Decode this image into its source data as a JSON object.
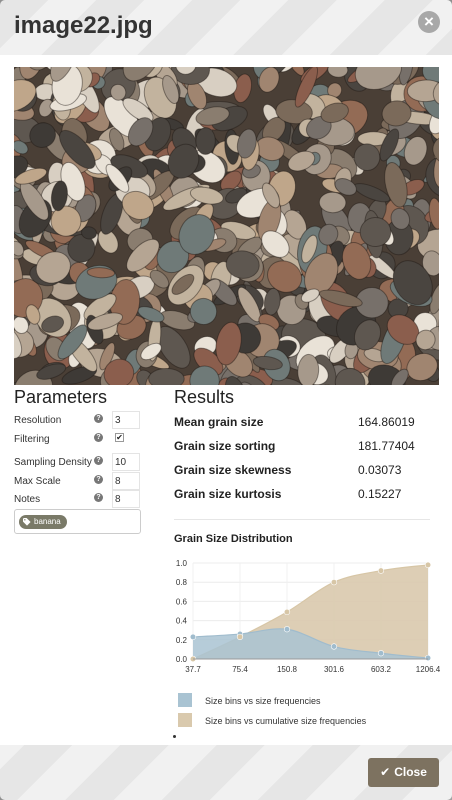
{
  "modal": {
    "title": "image22.jpg",
    "close_icon": "close-icon",
    "close_label": "Close"
  },
  "parameters": {
    "title": "Parameters",
    "rows": [
      {
        "label": "Resolution",
        "value": "3",
        "kind": "input"
      },
      {
        "label": "Filtering",
        "value": "✔",
        "kind": "checkbox"
      },
      {
        "label": "Sampling Density",
        "value": "10",
        "kind": "input"
      },
      {
        "label": "Max Scale",
        "value": "8",
        "kind": "input"
      },
      {
        "label": "Notes",
        "value": "8",
        "kind": "input"
      }
    ],
    "tag": "banana"
  },
  "results": {
    "title": "Results",
    "rows": [
      {
        "label": "Mean grain size",
        "value": "164.86019"
      },
      {
        "label": "Grain size sorting",
        "value": "181.77404"
      },
      {
        "label": "Grain size skewness",
        "value": "0.03073"
      },
      {
        "label": "Grain size kurtosis",
        "value": "0.15227"
      }
    ]
  },
  "chart_title": "Grain Size Distribution",
  "chart_data": {
    "type": "area",
    "title": "Grain Size Distribution",
    "categories": [
      "37.7",
      "75.4",
      "150.8",
      "301.6",
      "603.2",
      "1206.4"
    ],
    "ylim": [
      0,
      1.0
    ],
    "yticks": [
      "0.0",
      "0.2",
      "0.4",
      "0.6",
      "0.8",
      "1.0"
    ],
    "grid": true,
    "legend_position": "bottom",
    "series": [
      {
        "name": "Size bins vs size frequencies",
        "color": "#a9c3d2",
        "line": "#a0bccd",
        "values": [
          0.23,
          0.26,
          0.31,
          0.13,
          0.06,
          0.01
        ]
      },
      {
        "name": "Size bins vs cumulative size frequencies",
        "color": "#d9c9ad",
        "line": "#d7c6a6",
        "values": [
          0.0,
          0.23,
          0.49,
          0.8,
          0.92,
          0.98
        ]
      }
    ]
  },
  "colors": {
    "accent": "#7d7260",
    "tag": "#7a7a68"
  }
}
